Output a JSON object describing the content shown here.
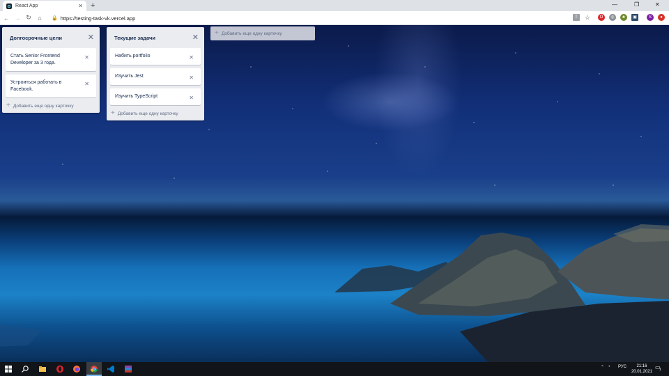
{
  "browser": {
    "tab_title": "React App",
    "tab_close": "✕",
    "new_tab": "+",
    "url": "https://testing-task-vk.vercel.app",
    "window_minimize": "—",
    "window_restore": "❐",
    "window_close": "✕"
  },
  "board": {
    "columns": [
      {
        "title": "Долгосрочные цели",
        "cards": [
          {
            "text": "Стать Senior Frontend Developer за 3 года."
          },
          {
            "text": "Устроиться работать в Facebook."
          }
        ],
        "add_card": "Добавить еще одну карточку"
      },
      {
        "title": "Текущие задачи",
        "cards": [
          {
            "text": "Набить portfolio"
          },
          {
            "text": "Изучить Jest"
          },
          {
            "text": "Изучить TypeScript"
          }
        ],
        "add_card": "Добавить еще одну карточку"
      }
    ],
    "add_column": "Добавить еще одну карточку",
    "close_glyph": "✕",
    "plus_glyph": "+"
  },
  "taskbar": {
    "language": "РУС",
    "time": "21:16",
    "date": "20.01.2021",
    "notifications_badge": "1"
  },
  "colors": {
    "column_bg": "#ebecf0",
    "card_text": "#172b4d",
    "muted": "#5e6c84"
  }
}
